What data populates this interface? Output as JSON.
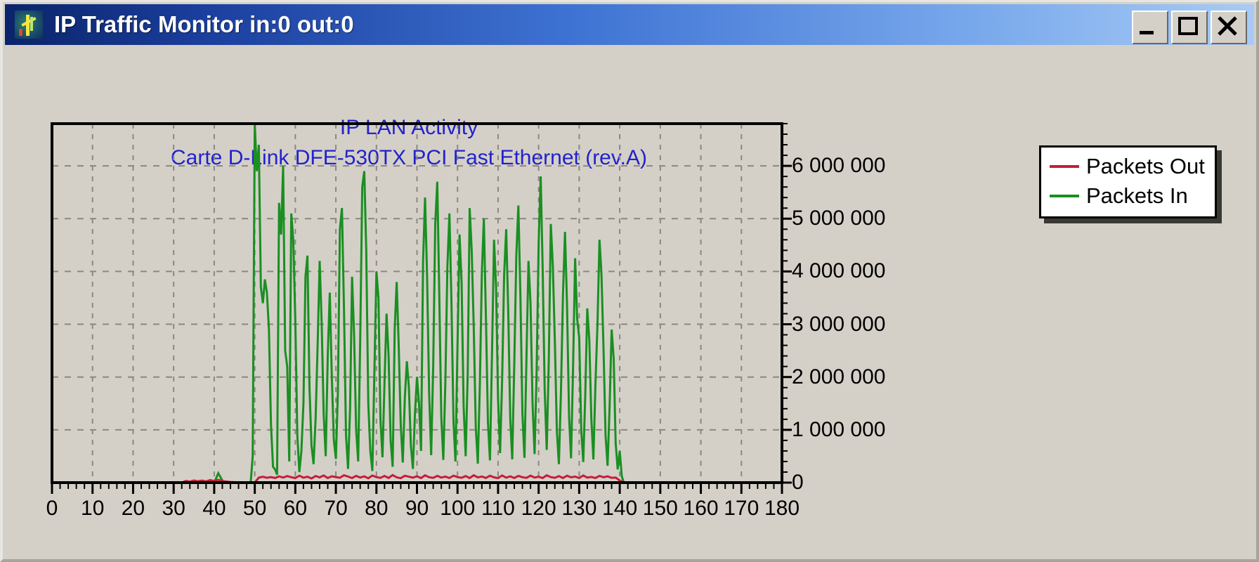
{
  "window": {
    "title": "IP Traffic Monitor in:0 out:0",
    "icon": "network-activity-icon",
    "controls": {
      "minimize": "minimize-button",
      "maximize": "maximize-button",
      "close": "close-button"
    },
    "background_color": "#d4d0c8",
    "titlebar_color": "#0a246a"
  },
  "chart_data": {
    "type": "line",
    "title": "IP LAN Activity",
    "subtitle": "Carte D-Link DFE-530TX PCI Fast Ethernet (rev.A)",
    "title_color": "#2222cc",
    "xlabel": "",
    "ylabel": "",
    "xlim": [
      0,
      180
    ],
    "ylim": [
      0,
      6800000
    ],
    "xticks": [
      0,
      10,
      20,
      30,
      40,
      50,
      60,
      70,
      80,
      90,
      100,
      110,
      120,
      130,
      140,
      150,
      160,
      170,
      180
    ],
    "xtick_labels": [
      "0",
      "10",
      "20",
      "30",
      "40",
      "50",
      "60",
      "70",
      "80",
      "90",
      "100",
      "110",
      "120",
      "130",
      "140",
      "150",
      "160",
      "170",
      "180"
    ],
    "yticks": [
      0,
      1000000,
      2000000,
      3000000,
      4000000,
      5000000,
      6000000
    ],
    "ytick_labels": [
      "0",
      "1 000 000",
      "2 000 000",
      "3 000 000",
      "4 000 000",
      "5 000 000",
      "6 000 000"
    ],
    "grid": true,
    "grid_style": "dashed",
    "grid_color": "#8a8880",
    "y_axis_position": "right",
    "legend_position": "upper right outside",
    "series": [
      {
        "name": "Packets Out",
        "color": "#c41e3a",
        "x": [
          0,
          2,
          4,
          6,
          8,
          10,
          12,
          14,
          16,
          18,
          20,
          22,
          24,
          26,
          28,
          30,
          31,
          32,
          33,
          34,
          35,
          36,
          37,
          38,
          39,
          40,
          41,
          42,
          43,
          44,
          45,
          46,
          47,
          48,
          49,
          50,
          51,
          52,
          53,
          54,
          55,
          56,
          57,
          58,
          59,
          60,
          61,
          62,
          63,
          64,
          65,
          66,
          67,
          68,
          69,
          70,
          71,
          72,
          73,
          74,
          75,
          76,
          77,
          78,
          79,
          80,
          81,
          82,
          83,
          84,
          85,
          86,
          87,
          88,
          89,
          90,
          91,
          92,
          93,
          94,
          95,
          96,
          97,
          98,
          99,
          100,
          101,
          102,
          103,
          104,
          105,
          106,
          107,
          108,
          109,
          110,
          111,
          112,
          113,
          114,
          115,
          116,
          117,
          118,
          119,
          120,
          121,
          122,
          123,
          124,
          125,
          126,
          127,
          128,
          129,
          130,
          131,
          132,
          133,
          134,
          135,
          136,
          137,
          138,
          139,
          140,
          141,
          142,
          143,
          144,
          145,
          146,
          148,
          150,
          160,
          170,
          180
        ],
        "values": [
          0,
          0,
          0,
          0,
          0,
          0,
          0,
          0,
          0,
          0,
          0,
          0,
          0,
          0,
          0,
          0,
          0,
          0,
          30000,
          18000,
          40000,
          25000,
          38000,
          22000,
          48000,
          30000,
          52000,
          28000,
          20000,
          12000,
          8000,
          5000,
          4000,
          3000,
          2000,
          0,
          95000,
          110000,
          92000,
          105000,
          88000,
          118000,
          96000,
          124000,
          102000,
          86000,
          130000,
          94000,
          112000,
          78000,
          125000,
          98000,
          136000,
          88000,
          120000,
          105000,
          92000,
          140000,
          115000,
          86000,
          128000,
          96000,
          118000,
          82000,
          135000,
          104000,
          90000,
          126000,
          88000,
          142000,
          100000,
          84000,
          130000,
          112000,
          95000,
          120000,
          86000,
          138000,
          102000,
          90000,
          128000,
          96000,
          115000,
          88000,
          132000,
          104000,
          92000,
          124000,
          86000,
          140000,
          98000,
          116000,
          88000,
          130000,
          100000,
          86000,
          136000,
          94000,
          118000,
          88000,
          126000,
          102000,
          90000,
          132000,
          96000,
          112000,
          86000,
          138000,
          104000,
          92000,
          122000,
          88000,
          130000,
          100000,
          114000,
          86000,
          134000,
          96000,
          108000,
          88000,
          126000,
          102000,
          118000,
          90000,
          96000,
          40000,
          0,
          0,
          0,
          0,
          0,
          0
        ]
      },
      {
        "name": "Packets In",
        "color": "#1a8f22",
        "x": [
          0,
          4,
          8,
          12,
          16,
          20,
          24,
          28,
          30,
          32,
          33,
          34,
          35,
          36,
          37,
          38,
          39,
          40,
          41,
          42,
          43,
          44,
          45,
          46,
          47,
          48,
          49,
          49.5,
          50,
          50.5,
          51,
          51.5,
          52,
          52.5,
          53,
          53.5,
          54,
          54.5,
          55,
          55.5,
          56,
          56.5,
          57,
          57.5,
          58,
          58.5,
          59,
          59.5,
          60,
          60.5,
          61,
          61.5,
          62,
          62.5,
          63,
          63.5,
          64,
          64.5,
          65,
          65.5,
          66,
          66.5,
          67,
          67.5,
          68,
          68.5,
          69,
          69.5,
          70,
          70.5,
          71,
          71.5,
          72,
          72.5,
          73,
          73.5,
          74,
          74.5,
          75,
          75.5,
          76,
          76.5,
          77,
          77.5,
          78,
          78.5,
          79,
          79.5,
          80,
          80.5,
          81,
          81.5,
          82,
          82.5,
          83,
          83.5,
          84,
          84.5,
          85,
          85.5,
          86,
          86.5,
          87,
          87.5,
          88,
          88.5,
          89,
          89.5,
          90,
          90.5,
          91,
          91.5,
          92,
          92.5,
          93,
          93.5,
          94,
          94.5,
          95,
          95.5,
          96,
          96.5,
          97,
          97.5,
          98,
          98.5,
          99,
          99.5,
          100,
          100.5,
          101,
          101.5,
          102,
          102.5,
          103,
          103.5,
          104,
          104.5,
          105,
          105.5,
          106,
          106.5,
          107,
          107.5,
          108,
          108.5,
          109,
          109.5,
          110,
          110.5,
          111,
          111.5,
          112,
          112.5,
          113,
          113.5,
          114,
          114.5,
          115,
          115.5,
          116,
          116.5,
          117,
          117.5,
          118,
          118.5,
          119,
          119.5,
          120,
          120.5,
          121,
          121.5,
          122,
          122.5,
          123,
          123.5,
          124,
          124.5,
          125,
          125.5,
          126,
          126.5,
          127,
          127.5,
          128,
          128.5,
          129,
          129.5,
          130,
          130.5,
          131,
          131.5,
          132,
          132.5,
          133,
          133.5,
          134,
          134.5,
          135,
          135.5,
          136,
          136.5,
          137,
          137.5,
          138,
          138.5,
          139,
          139.5,
          140,
          140.5,
          141,
          141.5,
          142,
          142.5,
          143,
          143.5,
          144,
          144.5,
          145,
          146,
          150,
          160,
          170,
          180
        ],
        "values": [
          0,
          0,
          0,
          0,
          0,
          0,
          0,
          0,
          0,
          0,
          20000,
          0,
          0,
          0,
          0,
          0,
          0,
          0,
          180000,
          40000,
          0,
          0,
          0,
          0,
          0,
          0,
          0,
          500000,
          6800000,
          5900000,
          6400000,
          3700000,
          3400000,
          3850000,
          3600000,
          2900000,
          1100000,
          300000,
          250000,
          150000,
          5300000,
          4700000,
          6000000,
          2500000,
          2200000,
          400000,
          5100000,
          4600000,
          3100000,
          900000,
          200000,
          600000,
          1500000,
          3900000,
          4300000,
          1800000,
          700000,
          350000,
          1200000,
          2600000,
          4200000,
          3000000,
          1300000,
          500000,
          2400000,
          3600000,
          2000000,
          800000,
          450000,
          1700000,
          4800000,
          5200000,
          3300000,
          900000,
          260000,
          1400000,
          3900000,
          2800000,
          1000000,
          400000,
          2700000,
          5600000,
          5900000,
          4400000,
          1500000,
          600000,
          220000,
          2100000,
          4000000,
          3500000,
          1200000,
          480000,
          1900000,
          3200000,
          2400000,
          800000,
          300000,
          2900000,
          3800000,
          2600000,
          1100000,
          380000,
          1600000,
          2300000,
          1800000,
          700000,
          260000,
          1300000,
          2000000,
          1500000,
          600000,
          4200000,
          5400000,
          3900000,
          1700000,
          520000,
          2200000,
          4900000,
          5700000,
          3600000,
          1250000,
          430000,
          1900000,
          4100000,
          5100000,
          3400000,
          1150000,
          400000,
          2600000,
          4700000,
          3800000,
          1450000,
          500000,
          2050000,
          5200000,
          4400000,
          2950000,
          1050000,
          360000,
          1850000,
          4000000,
          5000000,
          3150000,
          1150000,
          420000,
          2450000,
          4600000,
          3700000,
          1600000,
          560000,
          1950000,
          3950000,
          4800000,
          3250000,
          1200000,
          440000,
          2250000,
          4300000,
          5250000,
          3550000,
          1300000,
          470000,
          2400000,
          4200000,
          3400000,
          1500000,
          540000,
          2100000,
          4550000,
          5800000,
          4050000,
          1750000,
          620000,
          2300000,
          4900000,
          4100000,
          2650000,
          980000,
          350000,
          1700000,
          3550000,
          4750000,
          3350000,
          1250000,
          460000,
          2200000,
          4250000,
          3100000,
          2750000,
          1000000,
          390000,
          1650000,
          3300000,
          2700000,
          1200000,
          440000,
          1850000,
          3000000,
          4600000,
          3950000,
          2550000,
          900000,
          320000,
          1450000,
          2900000,
          2350000,
          750000,
          250000,
          600000,
          120000,
          0,
          0,
          0,
          0,
          0,
          0
        ]
      }
    ]
  },
  "legend": {
    "items": [
      {
        "label": "Packets Out",
        "color": "#c41e3a"
      },
      {
        "label": "Packets In",
        "color": "#1a8f22"
      }
    ]
  }
}
